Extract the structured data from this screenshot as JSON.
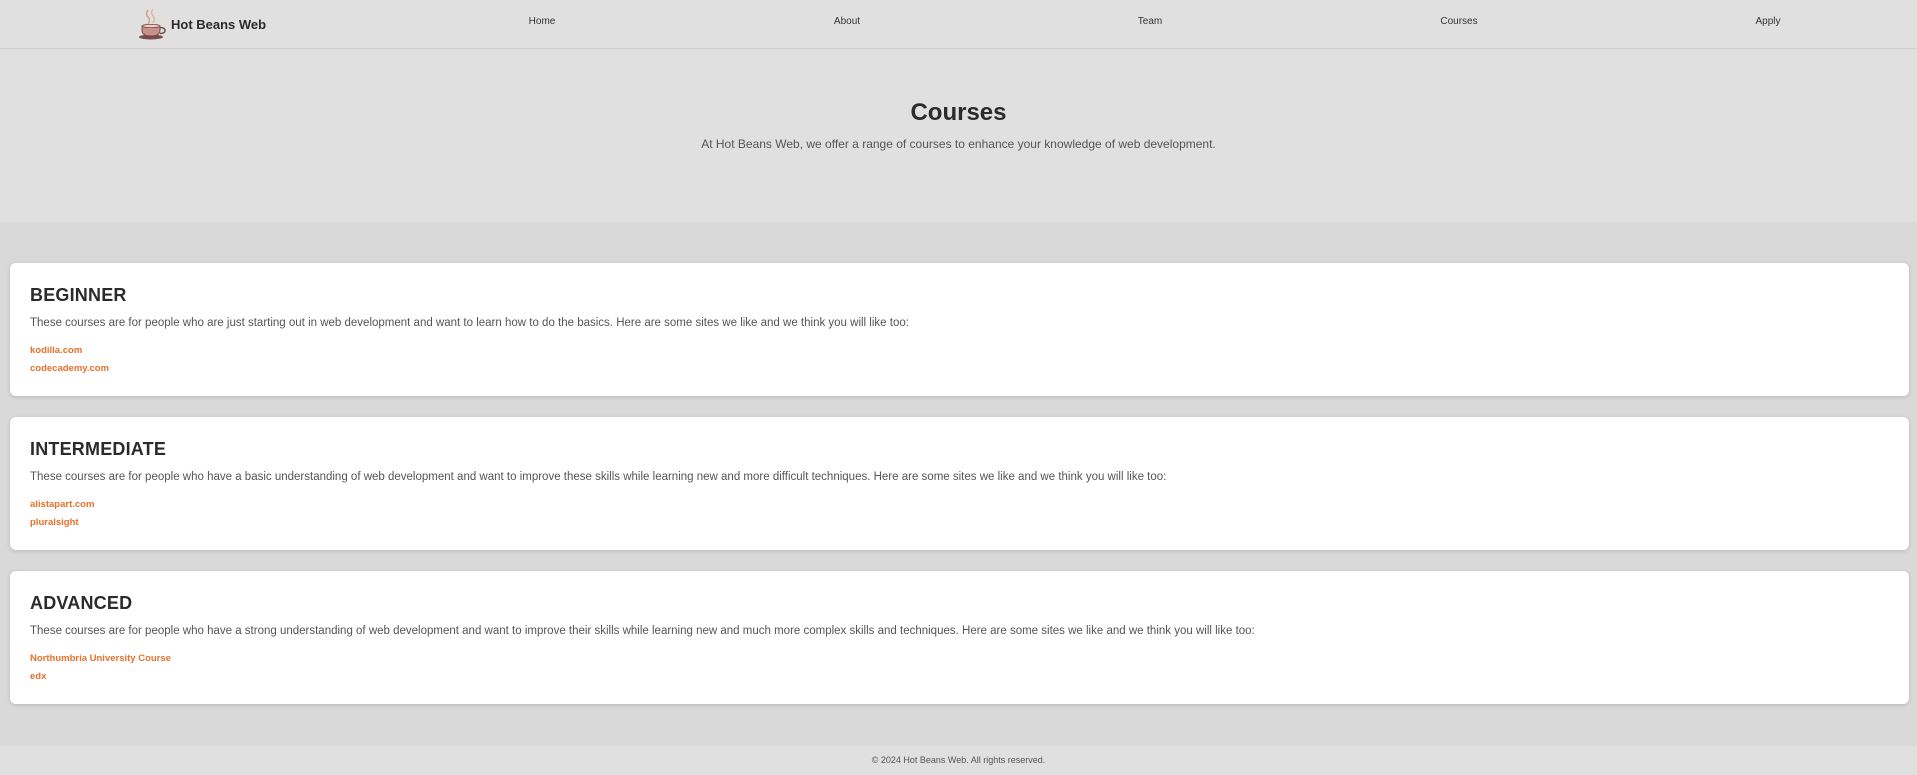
{
  "brand": {
    "name": "Hot Beans Web",
    "logo_icon": "coffee-cup-icon"
  },
  "nav": {
    "items": [
      {
        "label": "Home"
      },
      {
        "label": "About"
      },
      {
        "label": "Team"
      },
      {
        "label": "Courses"
      },
      {
        "label": "Apply"
      }
    ]
  },
  "hero": {
    "title": "Courses",
    "subtitle": "At Hot Beans Web, we offer a range of courses to enhance your knowledge of web development."
  },
  "courses": [
    {
      "title": "BEGINNER",
      "description": "These courses are for people who are just starting out in web development and want to learn how to do the basics. Here are some sites we like and we think you will like too:",
      "links": [
        "kodilla.com",
        "codecademy.com"
      ]
    },
    {
      "title": "INTERMEDIATE",
      "description": "These courses are for people who have a basic understanding of web development and want to improve these skills while learning new and more difficult techniques. Here are some sites we like and we think you will like too:",
      "links": [
        "alistapart.com",
        "pluralsight"
      ]
    },
    {
      "title": "ADVANCED",
      "description": "These courses are for people who have a strong understanding of web development and want to improve their skills while learning new and much more complex skills and techniques. Here are some sites we like and we think you will like too:",
      "links": [
        "Northumbria University Course",
        "edx"
      ]
    }
  ],
  "footer": {
    "text": "© 2024 Hot Beans Web. All rights reserved."
  },
  "colors": {
    "accent": "#e8702a",
    "background": "#d9d9d9",
    "card": "#ffffff"
  }
}
